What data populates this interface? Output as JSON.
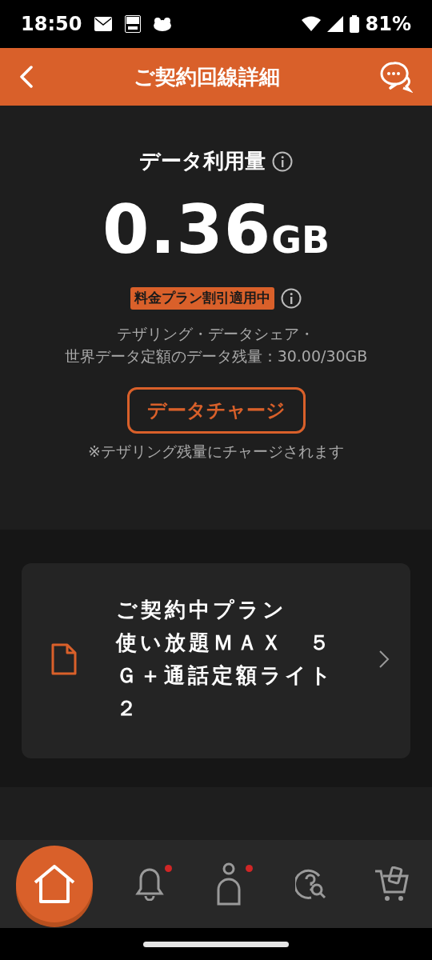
{
  "status_bar": {
    "time": "18:50",
    "battery": "81%"
  },
  "header": {
    "title": "ご契約回線詳細"
  },
  "usage": {
    "title": "データ利用量",
    "amount": "0.36",
    "unit": "GB",
    "discount_badge": "料金プラン割引適用中",
    "remaining": [
      "テザリング・データシェア・",
      "世界データ定額のデータ残量：30.00/30GB"
    ],
    "charge_button": "データチャージ",
    "note": "※テザリング残量にチャージされます"
  },
  "plan_card": {
    "label": "ご契約中プラン",
    "plan": "使い放題ＭＡＸ　５Ｇ＋通話定額ライト２"
  },
  "bottom_nav": [
    {
      "kind": "home",
      "selected": true,
      "badge": false
    },
    {
      "kind": "bell",
      "selected": false,
      "badge": true
    },
    {
      "kind": "person",
      "selected": false,
      "badge": true
    },
    {
      "kind": "help",
      "selected": false,
      "badge": false
    },
    {
      "kind": "cart",
      "selected": false,
      "badge": false
    }
  ]
}
